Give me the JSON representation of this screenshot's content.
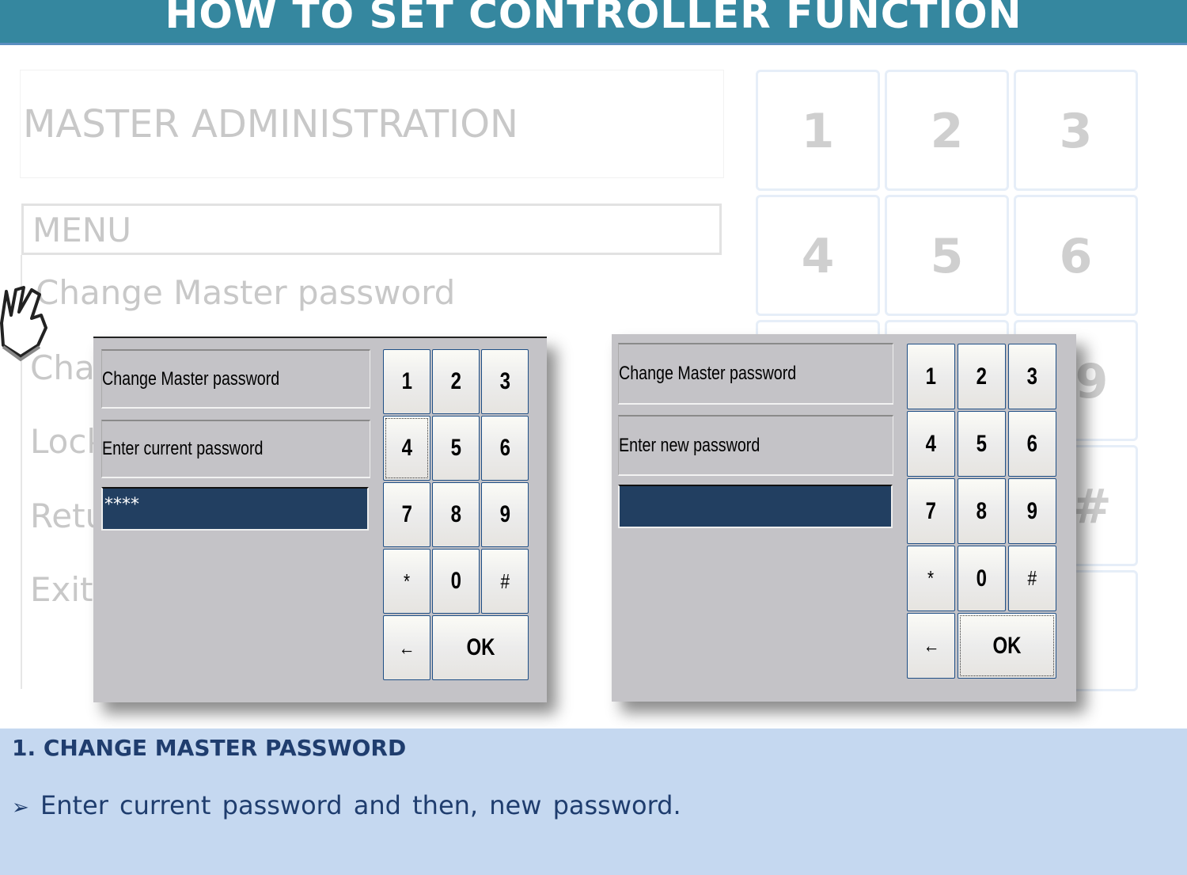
{
  "header": {
    "title": "HOW TO SET CONTROLLER FUNCTION"
  },
  "background": {
    "title": "MASTER ADMINISTRATION",
    "menu": "MENU",
    "items": [
      "Change Master password",
      "Cha",
      "Lock",
      "Retu",
      "Exit"
    ],
    "keys": [
      "1",
      "2",
      "3",
      "4",
      "5",
      "6",
      "9",
      "#"
    ]
  },
  "dialog1": {
    "title": "Change Master password",
    "prompt": "Enter current password",
    "value": "****",
    "keys": [
      "1",
      "2",
      "3",
      "4",
      "5",
      "6",
      "7",
      "8",
      "9",
      "*",
      "0",
      "#",
      "←",
      "OK"
    ],
    "focused_key": "4"
  },
  "dialog2": {
    "title": "Change Master password",
    "prompt": "Enter new password",
    "value": "",
    "keys": [
      "1",
      "2",
      "3",
      "4",
      "5",
      "6",
      "7",
      "8",
      "9",
      "*",
      "0",
      "#",
      "←",
      "OK"
    ],
    "focused_key": "OK"
  },
  "caption": {
    "section": "1. CHANGE MASTER PASSWORD",
    "bullet_icon": "arrowhead-bullet",
    "bullet": "Enter current password and then, new password."
  },
  "colors": {
    "header": "#35879f",
    "band": "#c5d8f0",
    "password_field": "#223f61",
    "dialog": "#c4c3c7"
  }
}
